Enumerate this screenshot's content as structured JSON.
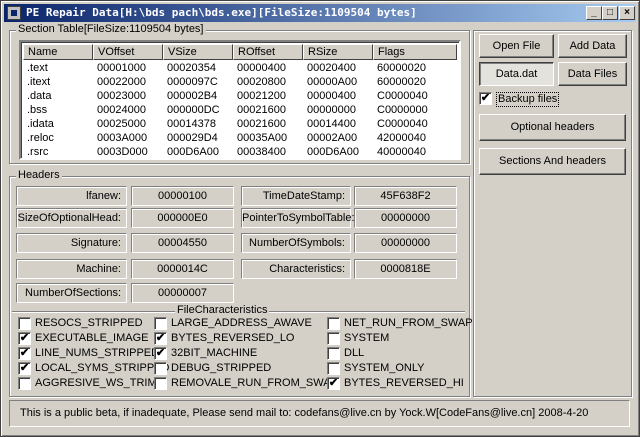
{
  "window": {
    "title": "PE Repair Data[H:\\bds pach\\bds.exe][FileSize:1109504 bytes]",
    "minimize_glyph": "_",
    "maximize_glyph": "□",
    "close_glyph": "×"
  },
  "section_table": {
    "label": "Section Table[FileSize:1109504 bytes]",
    "columns": [
      "Name",
      "VOffset",
      "VSize",
      "ROffset",
      "RSize",
      "Flags"
    ],
    "rows": [
      [
        ".text",
        "00001000",
        "00020354",
        "00000400",
        "00020400",
        "60000020"
      ],
      [
        ".itext",
        "00022000",
        "0000097C",
        "00020800",
        "00000A00",
        "60000020"
      ],
      [
        ".data",
        "00023000",
        "000002B4",
        "00021200",
        "00000400",
        "C0000040"
      ],
      [
        ".bss",
        "00024000",
        "000000DC",
        "00021600",
        "00000000",
        "C0000000"
      ],
      [
        ".idata",
        "00025000",
        "00014378",
        "00021600",
        "00014400",
        "C0000040"
      ],
      [
        ".reloc",
        "0003A000",
        "000029D4",
        "00035A00",
        "00002A00",
        "42000040"
      ],
      [
        ".rsrc",
        "0003D000",
        "000D6A00",
        "00038400",
        "000D6A00",
        "40000040"
      ]
    ]
  },
  "buttons": {
    "open_file": "Open File",
    "add_data": "Add Data",
    "data_dat": "Data.dat",
    "data_files": "Data Files",
    "optional_headers": "Optional headers",
    "sections_and_headers": "Sections And headers"
  },
  "backup": {
    "label": "Backup files",
    "checked": true,
    "mark": "✔"
  },
  "headers": {
    "label": "Headers",
    "left": [
      {
        "name": "lfanew:",
        "value": "00000100"
      },
      {
        "name": "SizeOfOptionalHead:",
        "value": "000000E0"
      },
      {
        "name": "Signature:",
        "value": "00004550"
      },
      {
        "name": "Machine:",
        "value": "0000014C"
      },
      {
        "name": "NumberOfSections:",
        "value": "00000007"
      }
    ],
    "right": [
      {
        "name": "TimeDateStamp:",
        "value": "45F638F2"
      },
      {
        "name": "PointerToSymbolTable:",
        "value": "00000000"
      },
      {
        "name": "NumberOfSymbols:",
        "value": "00000000"
      },
      {
        "name": "Characteristics:",
        "value": "0000818E"
      }
    ]
  },
  "file_characteristics": {
    "label": "FileCharacteristics",
    "mark": "✔",
    "columns": [
      [
        {
          "label": "RESOCS_STRIPPED",
          "checked": false
        },
        {
          "label": "EXECUTABLE_IMAGE",
          "checked": true
        },
        {
          "label": "LINE_NUMS_STRIPPED",
          "checked": true
        },
        {
          "label": "LOCAL_SYMS_STRIPPED",
          "checked": true
        },
        {
          "label": "AGGRESIVE_WS_TRIM",
          "checked": false
        }
      ],
      [
        {
          "label": "LARGE_ADDRESS_AWAVE",
          "checked": false
        },
        {
          "label": "BYTES_REVERSED_LO",
          "checked": true
        },
        {
          "label": "32BIT_MACHINE",
          "checked": true
        },
        {
          "label": "DEBUG_STRIPPED",
          "checked": false
        },
        {
          "label": "REMOVALE_RUN_FROM_SWAP",
          "checked": false
        }
      ],
      [
        {
          "label": "NET_RUN_FROM_SWAP",
          "checked": false
        },
        {
          "label": "SYSTEM",
          "checked": false
        },
        {
          "label": "DLL",
          "checked": false
        },
        {
          "label": "SYSTEM_ONLY",
          "checked": false
        },
        {
          "label": "BYTES_REVERSED_HI",
          "checked": true
        }
      ]
    ]
  },
  "status": {
    "text": "This is a public beta, if inadequate, Please send mail to: codefans@live.cn  by  Yock.W[CodeFans@live.cn] 2008-4-20"
  }
}
